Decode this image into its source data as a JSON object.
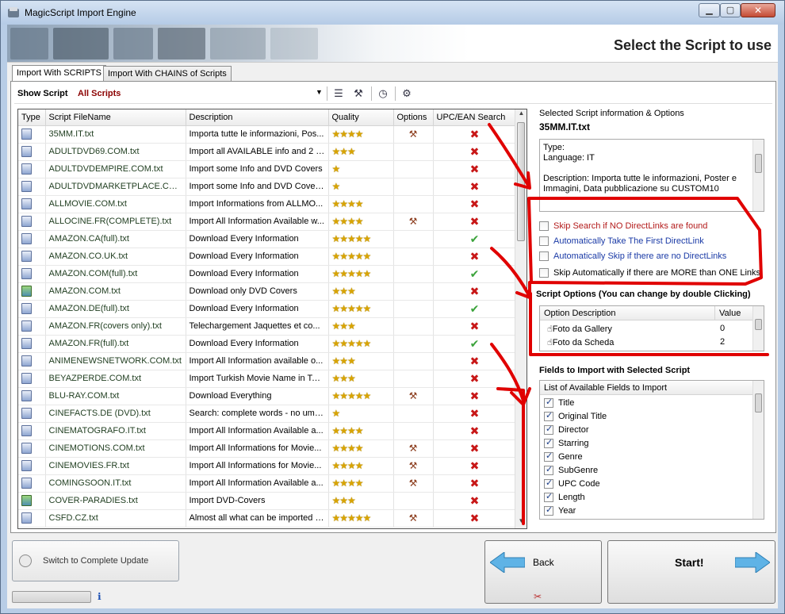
{
  "window": {
    "title": "MagicScript Import Engine"
  },
  "header": {
    "title": "Select the Script to use"
  },
  "tabs": [
    {
      "label": "Import With SCRIPTS"
    },
    {
      "label": "Import With CHAINS of Scripts"
    }
  ],
  "toolbar": {
    "show_label": "Show Script",
    "show_value": "All Scripts"
  },
  "grid": {
    "columns": [
      "Type",
      "Script FileName",
      "Description",
      "Quality",
      "Options",
      "UPC/EAN Search"
    ],
    "rows": [
      {
        "type": "doc",
        "name": "35MM.IT.txt",
        "desc": "Importa tutte le informazioni, Pos...",
        "stars": "★★★★",
        "options": true,
        "upc": false
      },
      {
        "type": "doc",
        "name": "ADULTDVD69.COM.txt",
        "desc": "Import all AVAILABLE info and 2 l...",
        "stars": "★★★",
        "options": false,
        "upc": false
      },
      {
        "type": "doc",
        "name": "ADULTDVDEMPIRE.COM.txt",
        "desc": "Import some Info and DVD Covers",
        "stars": "★",
        "options": false,
        "upc": false
      },
      {
        "type": "doc",
        "name": "ADULTDVDMARKETPLACE.COM.txt",
        "desc": "Import some Info and DVD Cover...",
        "stars": "★",
        "options": false,
        "upc": false
      },
      {
        "type": "doc",
        "name": "ALLMOVIE.COM.txt",
        "desc": "Import Informations from ALLMO...",
        "stars": "★★★★",
        "options": false,
        "upc": false
      },
      {
        "type": "doc",
        "name": "ALLOCINE.FR(COMPLETE).txt",
        "desc": "Import All Information Available w...",
        "stars": "★★★★",
        "options": true,
        "upc": false
      },
      {
        "type": "doc",
        "name": "AMAZON.CA(full).txt",
        "desc": "Download Every Information",
        "stars": "★★★★★",
        "options": false,
        "upc": true
      },
      {
        "type": "doc",
        "name": "AMAZON.CO.UK.txt",
        "desc": "Download Every Information",
        "stars": "★★★★★",
        "options": false,
        "upc": false
      },
      {
        "type": "doc",
        "name": "AMAZON.COM(full).txt",
        "desc": "Download Every Information",
        "stars": "★★★★★",
        "options": false,
        "upc": true
      },
      {
        "type": "img",
        "name": "AMAZON.COM.txt",
        "desc": "Download only DVD Covers",
        "stars": "★★★",
        "options": false,
        "upc": false
      },
      {
        "type": "doc",
        "name": "AMAZON.DE(full).txt",
        "desc": "Download Every Information",
        "stars": "★★★★★",
        "options": false,
        "upc": true
      },
      {
        "type": "doc",
        "name": "AMAZON.FR(covers only).txt",
        "desc": "Telechargement Jaquettes et co...",
        "stars": "★★★",
        "options": false,
        "upc": false
      },
      {
        "type": "doc",
        "name": "AMAZON.FR(full).txt",
        "desc": "Download Every Information",
        "stars": "★★★★★",
        "options": false,
        "upc": true
      },
      {
        "type": "doc",
        "name": "ANIMENEWSNETWORK.COM.txt",
        "desc": "Import All Information available o...",
        "stars": "★★★",
        "options": false,
        "upc": false
      },
      {
        "type": "doc",
        "name": "BEYAZPERDE.COM.txt",
        "desc": "Import Turkish Movie Name in Tag...",
        "stars": "★★★",
        "options": false,
        "upc": false
      },
      {
        "type": "doc",
        "name": "BLU-RAY.COM.txt",
        "desc": "Download Everything",
        "stars": "★★★★★",
        "options": true,
        "upc": false
      },
      {
        "type": "doc",
        "name": "CINEFACTS.DE (DVD).txt",
        "desc": "Search: complete words - no umla...",
        "stars": "★",
        "options": false,
        "upc": false
      },
      {
        "type": "doc",
        "name": "CINEMATOGRAFO.IT.txt",
        "desc": "Import All Information Available a...",
        "stars": "★★★★",
        "options": false,
        "upc": false
      },
      {
        "type": "doc",
        "name": "CINEMOTIONS.COM.txt",
        "desc": "Import All Informations for Movie...",
        "stars": "★★★★",
        "options": true,
        "upc": false
      },
      {
        "type": "doc",
        "name": "CINEMOVIES.FR.txt",
        "desc": "Import All Informations for Movie...",
        "stars": "★★★★",
        "options": true,
        "upc": false
      },
      {
        "type": "doc",
        "name": "COMINGSOON.IT.txt",
        "desc": "Import All Information Available a...",
        "stars": "★★★★",
        "options": true,
        "upc": false
      },
      {
        "type": "img",
        "name": "COVER-PARADIES.txt",
        "desc": "Import DVD-Covers",
        "stars": "★★★",
        "options": false,
        "upc": false
      },
      {
        "type": "doc",
        "name": "CSFD.CZ.txt",
        "desc": "Almost all what can be imported is...",
        "stars": "★★★★★",
        "options": true,
        "upc": false
      }
    ]
  },
  "info": {
    "group_title": "Selected Script information & Options",
    "script_name": "35MM.IT.txt",
    "type_line": "Type:",
    "language_line": "Language: IT",
    "description_line": "Description: Importa tutte le informazioni, Poster e Immagini, Data pubblicazione su CUSTOM10"
  },
  "checks": [
    {
      "label": "Skip Search if NO DirectLinks are found",
      "color": "red",
      "checked": false
    },
    {
      "label": "Automatically Take The First DirectLink",
      "color": "blue",
      "checked": false
    },
    {
      "label": "Automatically Skip if there are no DirectLinks",
      "color": "blue",
      "checked": false
    },
    {
      "label": "Skip Automatically if there are MORE than ONE Links",
      "color": "black",
      "checked": false
    }
  ],
  "script_options": {
    "title": "Script Options (You can change by double Clicking)",
    "col_desc": "Option Description",
    "col_value": "Value",
    "rows": [
      {
        "desc": "Foto da Gallery",
        "value": "0"
      },
      {
        "desc": "Foto da Scheda",
        "value": "2"
      }
    ]
  },
  "fields": {
    "title": "Fields to Import with Selected Script",
    "header": "List of Available Fields to Import",
    "items": [
      "Title",
      "Original Title",
      "Director",
      "Starring",
      "Genre",
      "SubGenre",
      "UPC Code",
      "Length",
      "Year"
    ]
  },
  "buttons": {
    "switch": "Switch to Complete Update",
    "back": "Back",
    "start": "Start!"
  },
  "colors": {
    "annotation": "#e00000",
    "star": "#d9a400"
  }
}
